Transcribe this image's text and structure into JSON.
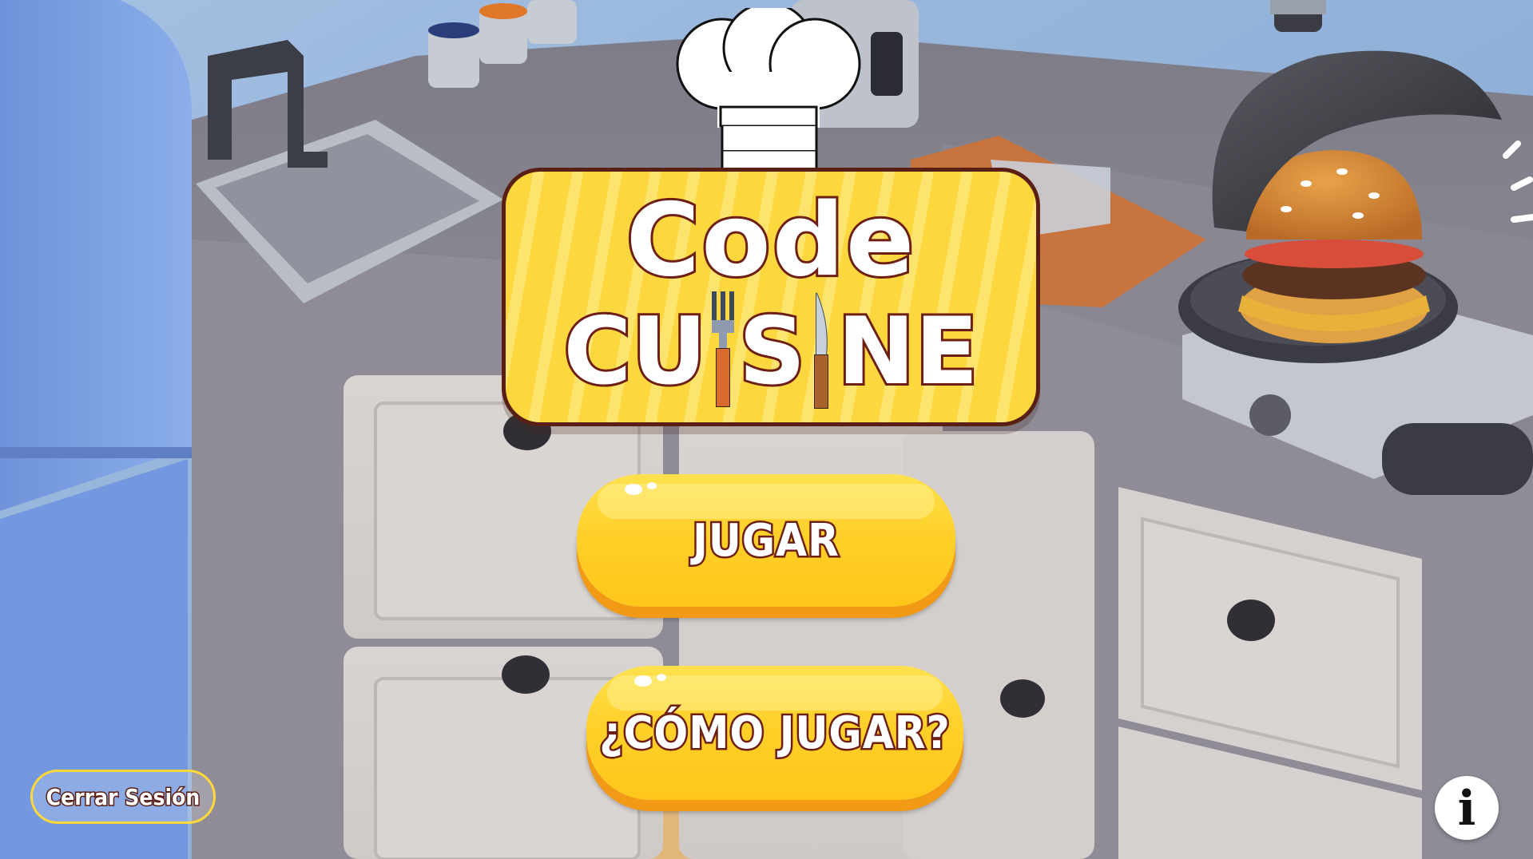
{
  "game": {
    "logo": {
      "line1": "Code",
      "line2_left": "CU",
      "line2_mid": "S",
      "line2_right": "NE"
    },
    "buttons": {
      "play": "JUGAR",
      "how_to_play": "¿CÓMO JUGAR?"
    },
    "logout": "Cerrar Sesión",
    "info_icon": "info-icon"
  },
  "colors": {
    "button_yellow": "#FFD02A",
    "button_shadow": "#F29A16",
    "text_outline": "#6E1F14",
    "wall_blue": "#8FB4DE",
    "counter_gray": "#8C8894"
  }
}
